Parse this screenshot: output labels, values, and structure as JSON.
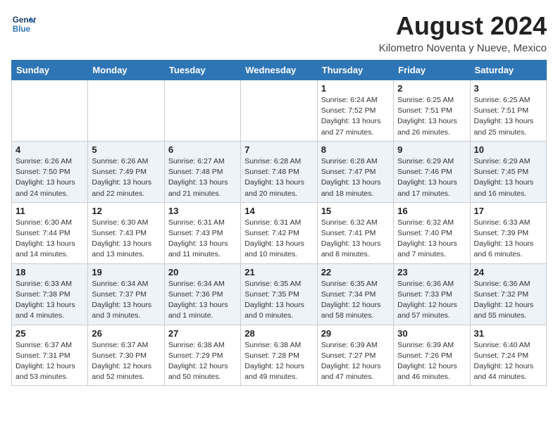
{
  "header": {
    "logo_line1": "General",
    "logo_line2": "Blue",
    "month_year": "August 2024",
    "location": "Kilometro Noventa y Nueve, Mexico"
  },
  "days_of_week": [
    "Sunday",
    "Monday",
    "Tuesday",
    "Wednesday",
    "Thursday",
    "Friday",
    "Saturday"
  ],
  "weeks": [
    [
      {
        "day": "",
        "info": ""
      },
      {
        "day": "",
        "info": ""
      },
      {
        "day": "",
        "info": ""
      },
      {
        "day": "",
        "info": ""
      },
      {
        "day": "1",
        "info": "Sunrise: 6:24 AM\nSunset: 7:52 PM\nDaylight: 13 hours and 27 minutes."
      },
      {
        "day": "2",
        "info": "Sunrise: 6:25 AM\nSunset: 7:51 PM\nDaylight: 13 hours and 26 minutes."
      },
      {
        "day": "3",
        "info": "Sunrise: 6:25 AM\nSunset: 7:51 PM\nDaylight: 13 hours and 25 minutes."
      }
    ],
    [
      {
        "day": "4",
        "info": "Sunrise: 6:26 AM\nSunset: 7:50 PM\nDaylight: 13 hours and 24 minutes."
      },
      {
        "day": "5",
        "info": "Sunrise: 6:26 AM\nSunset: 7:49 PM\nDaylight: 13 hours and 22 minutes."
      },
      {
        "day": "6",
        "info": "Sunrise: 6:27 AM\nSunset: 7:48 PM\nDaylight: 13 hours and 21 minutes."
      },
      {
        "day": "7",
        "info": "Sunrise: 6:28 AM\nSunset: 7:48 PM\nDaylight: 13 hours and 20 minutes."
      },
      {
        "day": "8",
        "info": "Sunrise: 6:28 AM\nSunset: 7:47 PM\nDaylight: 13 hours and 18 minutes."
      },
      {
        "day": "9",
        "info": "Sunrise: 6:29 AM\nSunset: 7:46 PM\nDaylight: 13 hours and 17 minutes."
      },
      {
        "day": "10",
        "info": "Sunrise: 6:29 AM\nSunset: 7:45 PM\nDaylight: 13 hours and 16 minutes."
      }
    ],
    [
      {
        "day": "11",
        "info": "Sunrise: 6:30 AM\nSunset: 7:44 PM\nDaylight: 13 hours and 14 minutes."
      },
      {
        "day": "12",
        "info": "Sunrise: 6:30 AM\nSunset: 7:43 PM\nDaylight: 13 hours and 13 minutes."
      },
      {
        "day": "13",
        "info": "Sunrise: 6:31 AM\nSunset: 7:43 PM\nDaylight: 13 hours and 11 minutes."
      },
      {
        "day": "14",
        "info": "Sunrise: 6:31 AM\nSunset: 7:42 PM\nDaylight: 13 hours and 10 minutes."
      },
      {
        "day": "15",
        "info": "Sunrise: 6:32 AM\nSunset: 7:41 PM\nDaylight: 13 hours and 8 minutes."
      },
      {
        "day": "16",
        "info": "Sunrise: 6:32 AM\nSunset: 7:40 PM\nDaylight: 13 hours and 7 minutes."
      },
      {
        "day": "17",
        "info": "Sunrise: 6:33 AM\nSunset: 7:39 PM\nDaylight: 13 hours and 6 minutes."
      }
    ],
    [
      {
        "day": "18",
        "info": "Sunrise: 6:33 AM\nSunset: 7:38 PM\nDaylight: 13 hours and 4 minutes."
      },
      {
        "day": "19",
        "info": "Sunrise: 6:34 AM\nSunset: 7:37 PM\nDaylight: 13 hours and 3 minutes."
      },
      {
        "day": "20",
        "info": "Sunrise: 6:34 AM\nSunset: 7:36 PM\nDaylight: 13 hours and 1 minute."
      },
      {
        "day": "21",
        "info": "Sunrise: 6:35 AM\nSunset: 7:35 PM\nDaylight: 13 hours and 0 minutes."
      },
      {
        "day": "22",
        "info": "Sunrise: 6:35 AM\nSunset: 7:34 PM\nDaylight: 12 hours and 58 minutes."
      },
      {
        "day": "23",
        "info": "Sunrise: 6:36 AM\nSunset: 7:33 PM\nDaylight: 12 hours and 57 minutes."
      },
      {
        "day": "24",
        "info": "Sunrise: 6:36 AM\nSunset: 7:32 PM\nDaylight: 12 hours and 55 minutes."
      }
    ],
    [
      {
        "day": "25",
        "info": "Sunrise: 6:37 AM\nSunset: 7:31 PM\nDaylight: 12 hours and 53 minutes."
      },
      {
        "day": "26",
        "info": "Sunrise: 6:37 AM\nSunset: 7:30 PM\nDaylight: 12 hours and 52 minutes."
      },
      {
        "day": "27",
        "info": "Sunrise: 6:38 AM\nSunset: 7:29 PM\nDaylight: 12 hours and 50 minutes."
      },
      {
        "day": "28",
        "info": "Sunrise: 6:38 AM\nSunset: 7:28 PM\nDaylight: 12 hours and 49 minutes."
      },
      {
        "day": "29",
        "info": "Sunrise: 6:39 AM\nSunset: 7:27 PM\nDaylight: 12 hours and 47 minutes."
      },
      {
        "day": "30",
        "info": "Sunrise: 6:39 AM\nSunset: 7:26 PM\nDaylight: 12 hours and 46 minutes."
      },
      {
        "day": "31",
        "info": "Sunrise: 6:40 AM\nSunset: 7:24 PM\nDaylight: 12 hours and 44 minutes."
      }
    ]
  ]
}
